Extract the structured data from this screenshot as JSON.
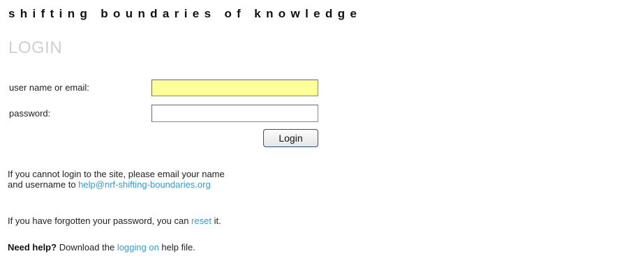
{
  "header": {
    "tagline": "shifting boundaries of knowledge"
  },
  "login": {
    "heading": "LOGIN",
    "username_label": "user name or email:",
    "username_value": "",
    "password_label": "password:",
    "password_value": "",
    "submit_label": "Login"
  },
  "info": {
    "cannot_login_line1": "If you cannot login to the site, please email your name",
    "cannot_login_line2_prefix": "and username to ",
    "help_email": "help@nrf-shifting-boundaries.org",
    "forgot_prefix": "If you have forgotten your password, you can ",
    "reset_link": "reset",
    "forgot_suffix": " it.",
    "need_help_bold": "Need help?",
    "need_help_prefix": " Download the ",
    "logging_on_link": "logging on",
    "need_help_suffix": " help file."
  },
  "colors": {
    "link": "#3a9ac9",
    "heading": "#cfcfcf",
    "username_field_bg": "#ffff99"
  }
}
